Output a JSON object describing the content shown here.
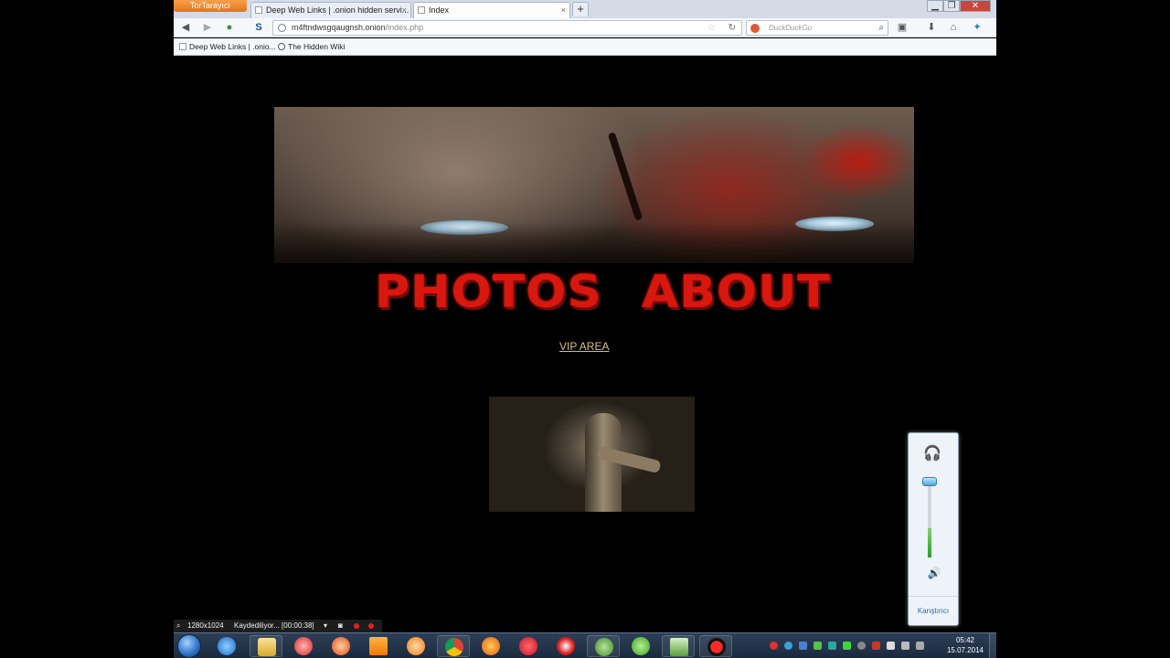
{
  "browser": {
    "app_button": "TorTarayıcı",
    "tabs": [
      {
        "label": "Deep Web Links | .onion hidden servi...",
        "close": "×"
      },
      {
        "label": "Index",
        "close": "×"
      }
    ],
    "new_tab": "+",
    "url_host": "m4ftndwsgqaugnsh.onion",
    "url_path": "/index.php",
    "search_placeholder": "DuckDuckGo",
    "bookmarks": [
      "Deep Web Links | .onio...",
      "The Hidden Wiki"
    ],
    "window_controls": {
      "minimize": "▁",
      "restore": "❐",
      "close": "✕"
    }
  },
  "page": {
    "nav_links": [
      "PHOTOS",
      "ABOUT"
    ],
    "vip_link": "VIP AREA"
  },
  "volume_flyout": {
    "level_percent": 100,
    "mixer_label": "Karıştırıcı"
  },
  "recorder": {
    "resolution": "1280x1024",
    "status": "Kaydediliyor... [00:00:38]"
  },
  "taskbar": {
    "time": "05:42",
    "date": "15.07.2014",
    "pinned_icons": [
      "ie-icon",
      "explorer-icon",
      "app-red-icon",
      "ccleaner-icon",
      "vlc-icon",
      "media-player-icon",
      "chrome-icon",
      "firefox-icon",
      "opera-icon",
      "yandex-icon",
      "tor-icon",
      "utorrent-icon",
      "screen-icon",
      "recorder-icon"
    ],
    "colors": {
      "accent": "#2d3f57",
      "blood": "#d8170f",
      "vip": "#d8c27e"
    }
  }
}
